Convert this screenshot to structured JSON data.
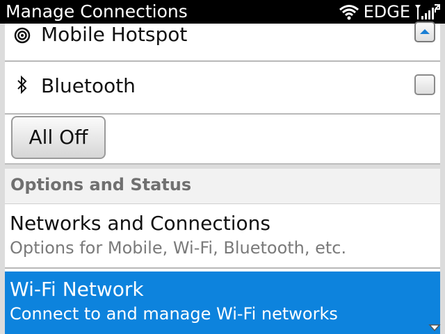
{
  "statusbar": {
    "title": "Manage Connections",
    "network_type": "EDGE",
    "icons": [
      "wifi-icon",
      "signal-strength-icon"
    ]
  },
  "connections": {
    "items": [
      {
        "label": "Mobile Hotspot",
        "icon": "hotspot-icon",
        "checked": false
      },
      {
        "label": "Bluetooth",
        "icon": "bluetooth-icon",
        "checked": false
      }
    ],
    "all_off_label": "All Off"
  },
  "options": {
    "header": "Options and Status",
    "items": [
      {
        "title": "Networks and Connections",
        "subtitle": "Options for Mobile, Wi-Fi, Bluetooth, etc.",
        "selected": false
      },
      {
        "title": "Wi-Fi Network",
        "subtitle": "Connect to and manage Wi-Fi networks",
        "selected": true
      }
    ]
  },
  "colors": {
    "selection": "#0d83dd",
    "statusbar": "#000000",
    "header_text": "#707070"
  }
}
